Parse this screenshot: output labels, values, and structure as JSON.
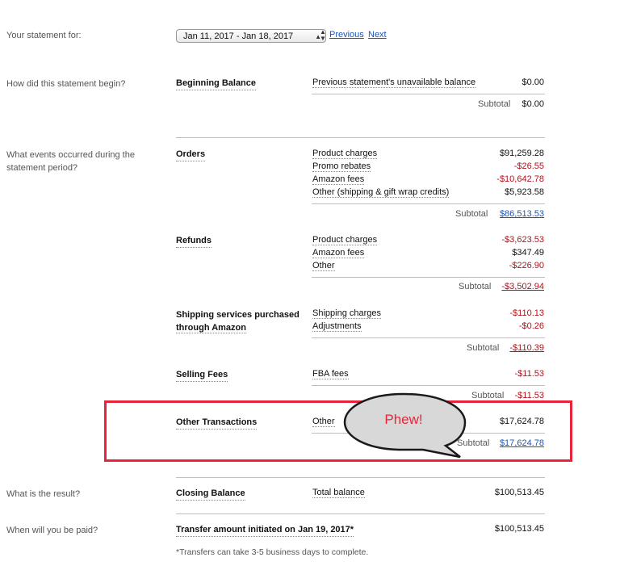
{
  "header": {
    "label": "Your statement for:",
    "date_range": "Jan 11, 2017 - Jan 18, 2017",
    "previous": "Previous",
    "next": "Next"
  },
  "questions": {
    "begin": "How did this statement begin?",
    "events": "What events occurred during the statement period?",
    "result": "What is the result?",
    "paid": "When will you be paid?"
  },
  "beginning": {
    "title": "Beginning Balance",
    "desc": "Previous statement's unavailable balance",
    "amount": "$0.00",
    "subtotal_label": "Subtotal",
    "subtotal": "$0.00"
  },
  "orders": {
    "title": "Orders",
    "rows": [
      {
        "label": "Product charges",
        "amount": "$91,259.28"
      },
      {
        "label": "Promo rebates",
        "amount": "-$26.55"
      },
      {
        "label": "Amazon fees",
        "amount": "-$10,642.78"
      },
      {
        "label": "Other (shipping & gift wrap credits)",
        "amount": "$5,923.58"
      }
    ],
    "subtotal_label": "Subtotal",
    "subtotal": "$86,513.53"
  },
  "refunds": {
    "title": "Refunds",
    "rows": [
      {
        "label": "Product charges",
        "amount": "-$3,623.53"
      },
      {
        "label": "Amazon fees",
        "amount": "$347.49"
      },
      {
        "label": "Other",
        "amount": "-$226.90"
      }
    ],
    "subtotal_label": "Subtotal",
    "subtotal": "-$3,502.94"
  },
  "shipping": {
    "title_line1": "Shipping services purchased",
    "title_line2": "through Amazon",
    "rows": [
      {
        "label": "Shipping charges",
        "amount": "-$110.13"
      },
      {
        "label": "Adjustments",
        "amount": "-$0.26"
      }
    ],
    "subtotal_label": "Subtotal",
    "subtotal": "-$110.39"
  },
  "selling": {
    "title": "Selling Fees",
    "rows": [
      {
        "label": "FBA fees",
        "amount": "-$11.53"
      }
    ],
    "subtotal_label": "Subtotal",
    "subtotal": "-$11.53"
  },
  "other_tx": {
    "title": "Other Transactions",
    "rows": [
      {
        "label": "Other",
        "amount": "$17,624.78"
      }
    ],
    "subtotal_label": "Subtotal",
    "subtotal": "$17,624.78",
    "bubble": "Phew!"
  },
  "closing": {
    "title": "Closing Balance",
    "desc": "Total balance",
    "amount": "$100,513.45"
  },
  "transfer": {
    "title": "Transfer amount initiated on Jan 19, 2017*",
    "amount": "$100,513.45",
    "footnote": "*Transfers can take 3-5 business days to complete."
  },
  "colors": {
    "negative": "#b0121b",
    "link": "#1a55b9",
    "highlight_box": "#e8243a"
  }
}
